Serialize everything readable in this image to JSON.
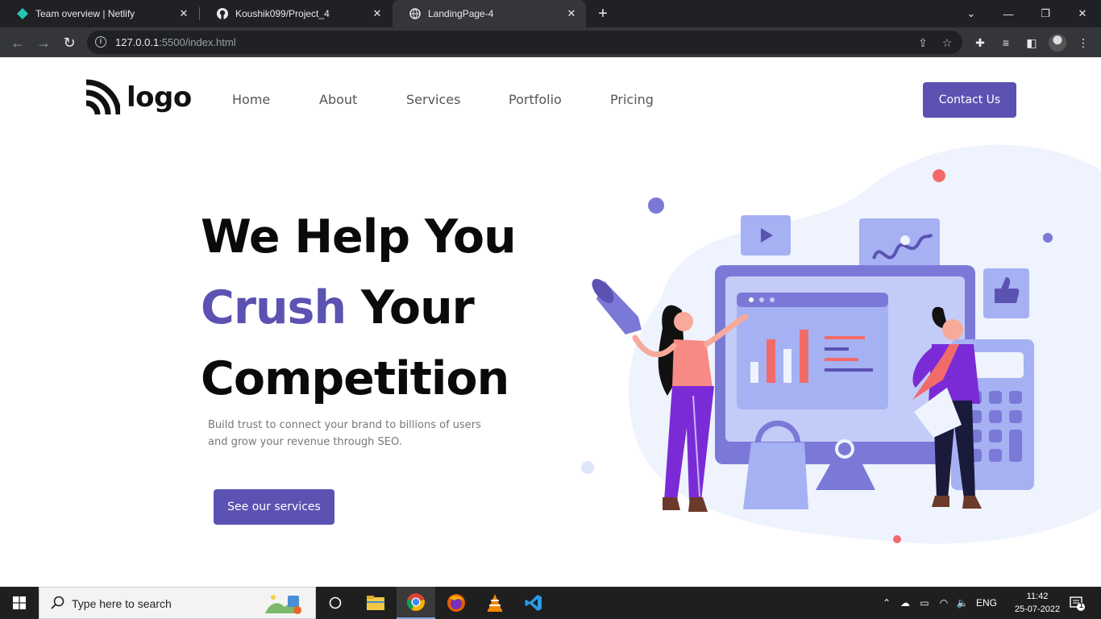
{
  "browser": {
    "tabs": [
      {
        "title": "Team overview | Netlify",
        "icon": "netlify-icon"
      },
      {
        "title": "Koushik099/Project_4",
        "icon": "github-icon"
      },
      {
        "title": "LandingPage-4",
        "icon": "globe-icon"
      }
    ],
    "url_host": "127.0.0.1",
    "url_path": ":5500/index.html"
  },
  "header": {
    "logo_text": "logo",
    "nav": [
      "Home",
      "About",
      "Services",
      "Portfolio",
      "Pricing"
    ],
    "contact_label": "Contact Us"
  },
  "hero": {
    "line1": "We Help You",
    "line2_accent": "Crush",
    "line2_rest": " Your",
    "line3": "Competition",
    "subtitle": "Build trust to connect your brand to billions of users and grow your revenue through SEO.",
    "cta_label": "See our services"
  },
  "colors": {
    "accent": "#5b52b2",
    "illustration_blob": "#eef3fd",
    "illustration_primary": "#7b79d8",
    "coral": "#f26b6b"
  },
  "taskbar": {
    "search_placeholder": "Type here to search",
    "language": "ENG",
    "time": "11:42",
    "date": "25-07-2022",
    "notification_count": "1"
  }
}
